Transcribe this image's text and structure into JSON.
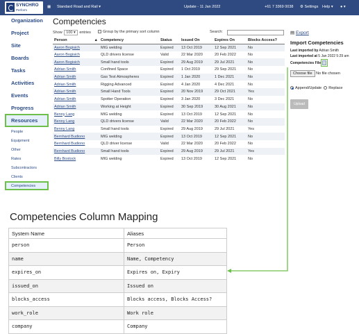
{
  "topbar": {
    "logo_name": "SYNCHRO",
    "logo_sub": "Perform",
    "company": "Standard Road and Rail",
    "update": "Update - 11 Jan 2022",
    "phone": "+61 7 3369 0038",
    "settings": "Settings",
    "help": "Help",
    "bg_color": "#2f4a80"
  },
  "sidebar": {
    "main": [
      "Organization",
      "Project",
      "Site",
      "Boards",
      "Tasks",
      "Activities",
      "Events",
      "Progress",
      "Resources"
    ],
    "sub": [
      "People",
      "Equipment",
      "Other",
      "Rates",
      "Subcontractors",
      "Clients",
      "Competencies"
    ],
    "highlight_color": "#6cc04a"
  },
  "main": {
    "title": "Competencies",
    "show_label": "Show",
    "show_value": "100",
    "entries_label": "entries",
    "group_label": "Group by the primary sort column",
    "search_label": "Search:",
    "export_label": "Export"
  },
  "table": {
    "columns": [
      "Person",
      "Competency",
      "Status",
      "Issued On",
      "Expires On",
      "Blocks Access?"
    ],
    "rows": [
      [
        "Aaron Bogisich",
        "MIG welding",
        "Expired",
        "13 Oct 2019",
        "12 Sep 2021",
        "No"
      ],
      [
        "Aaron Bogisich",
        "QLD drivers license",
        "Valid",
        "22 Mar 2020",
        "20 Feb 2022",
        "No"
      ],
      [
        "Aaron Bogisich",
        "Small hand tools",
        "Expired",
        "29 Aug 2019",
        "29 Jul 2021",
        "No"
      ],
      [
        "Adrian Smith",
        "Confined Space",
        "Expired",
        "1 Oct 2019",
        "29 Sep 2021",
        "No"
      ],
      [
        "Adrian Smith",
        "Gas Test Atmospheres",
        "Expired",
        "1 Jan 2020",
        "1 Dec 2021",
        "No"
      ],
      [
        "Adrian Smith",
        "Rigging Advanced",
        "Expired",
        "4 Jan 2020",
        "4 Dec 2021",
        "No"
      ],
      [
        "Adrian Smith",
        "Small Hand Tools",
        "Expired",
        "20 Nov 2019",
        "29 Oct 2021",
        "Yes"
      ],
      [
        "Adrian Smith",
        "Spotter Operation",
        "Expired",
        "3 Jan 2020",
        "3 Dec 2021",
        "No"
      ],
      [
        "Adrian Smith",
        "Working at Height",
        "Expired",
        "30 Sep 2019",
        "30 Aug 2021",
        "No"
      ],
      [
        "Benny Lang",
        "MIG welding",
        "Expired",
        "13 Oct 2019",
        "12 Sep 2021",
        "No"
      ],
      [
        "Benny Lang",
        "QLD drivers license",
        "Valid",
        "22 Mar 2020",
        "20 Feb 2022",
        "No"
      ],
      [
        "Benny Lang",
        "Small hand tools",
        "Expired",
        "29 Aug 2019",
        "29 Jul 2021",
        "Yes"
      ],
      [
        "Bernhard Budiono",
        "MIG welding",
        "Expired",
        "13 Oct 2019",
        "12 Sep 2021",
        "No"
      ],
      [
        "Bernhard Budiono",
        "QLD driver license",
        "Valid",
        "22 Mar 2020",
        "20 Feb 2022",
        "No"
      ],
      [
        "Bernhard Budiono",
        "Small hand tools",
        "Expired",
        "29 Aug 2019",
        "29 Jul 2021",
        "Yes"
      ],
      [
        "Billy Bostock",
        "MIG welding",
        "Expired",
        "13 Oct 2019",
        "12 Sep 2021",
        "No"
      ]
    ]
  },
  "import": {
    "title": "Import Competencies",
    "last_imported_by_label": "Last imported by",
    "last_imported_by": "Adrian Smith",
    "last_imported_at_label": "Last imported at",
    "last_imported_at": "5 Jan 2022 5:29 am",
    "file_label": "Competencies File",
    "choose_file": "Choose file",
    "no_file": "No file chosen",
    "option1": "Append/Update",
    "option2": "Replace",
    "upload": "Upload"
  },
  "mapping": {
    "title": "Competencies Column Mapping",
    "columns": [
      "System Name",
      "Aliases"
    ],
    "rows": [
      [
        "person",
        "Person"
      ],
      [
        "name",
        "Name, Competency"
      ],
      [
        "expires_on",
        "Expires on, Expiry"
      ],
      [
        "issued_on",
        "Issued on"
      ],
      [
        "blocks_access",
        "Blocks access, Blocks Access?"
      ],
      [
        "work_role",
        "Work role"
      ],
      [
        "company",
        "Company"
      ]
    ],
    "connector_color": "#6cc04a"
  }
}
